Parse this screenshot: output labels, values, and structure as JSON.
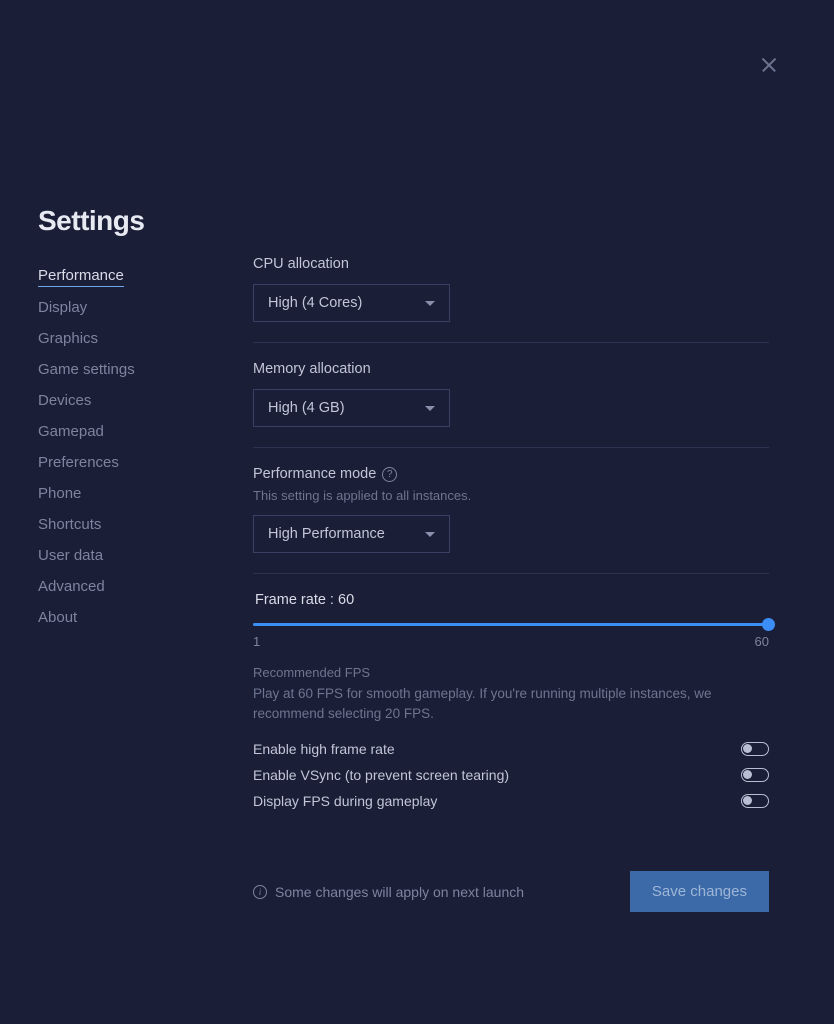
{
  "page_title": "Settings",
  "sidebar": {
    "items": [
      "Performance",
      "Display",
      "Graphics",
      "Game settings",
      "Devices",
      "Gamepad",
      "Preferences",
      "Phone",
      "Shortcuts",
      "User data",
      "Advanced",
      "About"
    ],
    "active_index": 0
  },
  "cpu": {
    "label": "CPU allocation",
    "value": "High (4 Cores)"
  },
  "memory": {
    "label": "Memory allocation",
    "value": "High (4 GB)"
  },
  "perfmode": {
    "label": "Performance mode",
    "note": "This setting is applied to all instances.",
    "value": "High Performance"
  },
  "framerate": {
    "label_prefix": "Frame rate : ",
    "value": "60",
    "min": "1",
    "max": "60",
    "rec_title": "Recommended FPS",
    "rec_body": "Play at 60 FPS for smooth gameplay. If you're running multiple instances, we recommend selecting 20 FPS."
  },
  "toggles": [
    {
      "label": "Enable high frame rate"
    },
    {
      "label": "Enable VSync (to prevent screen tearing)"
    },
    {
      "label": "Display FPS during gameplay"
    }
  ],
  "footer_note": "Some changes will apply on next launch",
  "save_label": "Save changes"
}
